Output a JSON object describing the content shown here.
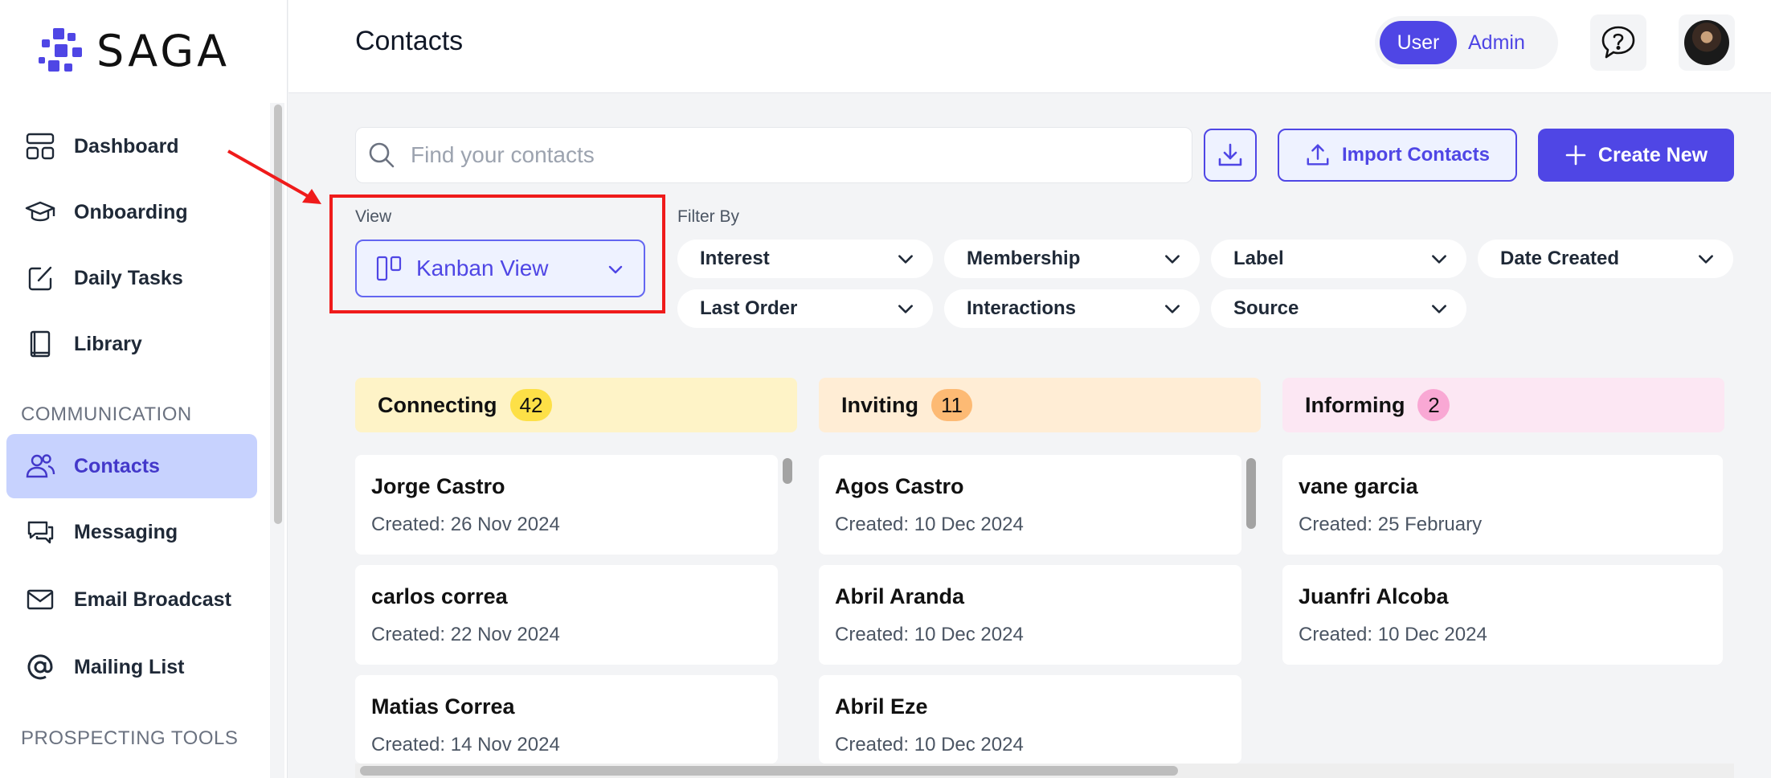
{
  "sidebar": {
    "logo_text": "SAGA",
    "items": [
      {
        "label": "Dashboard",
        "icon": "dashboard-icon"
      },
      {
        "label": "Onboarding",
        "icon": "graduation-cap-icon"
      },
      {
        "label": "Daily Tasks",
        "icon": "edit-square-icon"
      },
      {
        "label": "Library",
        "icon": "book-icon"
      }
    ],
    "section_communication": "COMMUNICATION",
    "comm_items": [
      {
        "label": "Contacts",
        "icon": "users-icon",
        "active": true
      },
      {
        "label": "Messaging",
        "icon": "chat-bubbles-icon"
      },
      {
        "label": "Email Broadcast",
        "icon": "mail-icon"
      },
      {
        "label": "Mailing List",
        "icon": "at-sign-icon"
      }
    ],
    "section_prospecting": "PROSPECTING TOOLS"
  },
  "header": {
    "title": "Contacts",
    "role_user": "User",
    "role_admin": "Admin"
  },
  "toolbar": {
    "search_placeholder": "Find your contacts",
    "import_label": "Import Contacts",
    "create_label": "Create New"
  },
  "view": {
    "label": "View",
    "selected": "Kanban View"
  },
  "filters": {
    "label": "Filter By",
    "items": [
      "Interest",
      "Membership",
      "Label",
      "Date Created",
      "Last Order",
      "Interactions",
      "Source"
    ]
  },
  "kanban": {
    "columns": [
      {
        "title": "Connecting",
        "count": "42",
        "color": "#fef3c7",
        "badge_color": "#fde047",
        "cards": [
          {
            "name": "Jorge Castro",
            "created": "Created: 26 Nov 2024"
          },
          {
            "name": "carlos correa",
            "created": "Created: 22 Nov 2024"
          },
          {
            "name": "Matias Correa",
            "created": "Created: 14 Nov 2024"
          }
        ]
      },
      {
        "title": "Inviting",
        "count": "11",
        "color": "#ffedd5",
        "badge_color": "#fdba74",
        "cards": [
          {
            "name": "Agos Castro",
            "created": "Created: 10 Dec 2024"
          },
          {
            "name": "Abril Aranda",
            "created": "Created: 10 Dec 2024"
          },
          {
            "name": "Abril Eze",
            "created": "Created: 10 Dec 2024"
          }
        ]
      },
      {
        "title": "Informing",
        "count": "2",
        "color": "#fce7f3",
        "badge_color": "#f9a8d4",
        "cards": [
          {
            "name": "vane garcia",
            "created": "Created: 25 February"
          },
          {
            "name": "Juanfri Alcoba",
            "created": "Created: 10 Dec 2024"
          }
        ]
      }
    ]
  },
  "colors": {
    "accent": "#4f46e5",
    "highlight": "#ef1b1b"
  }
}
